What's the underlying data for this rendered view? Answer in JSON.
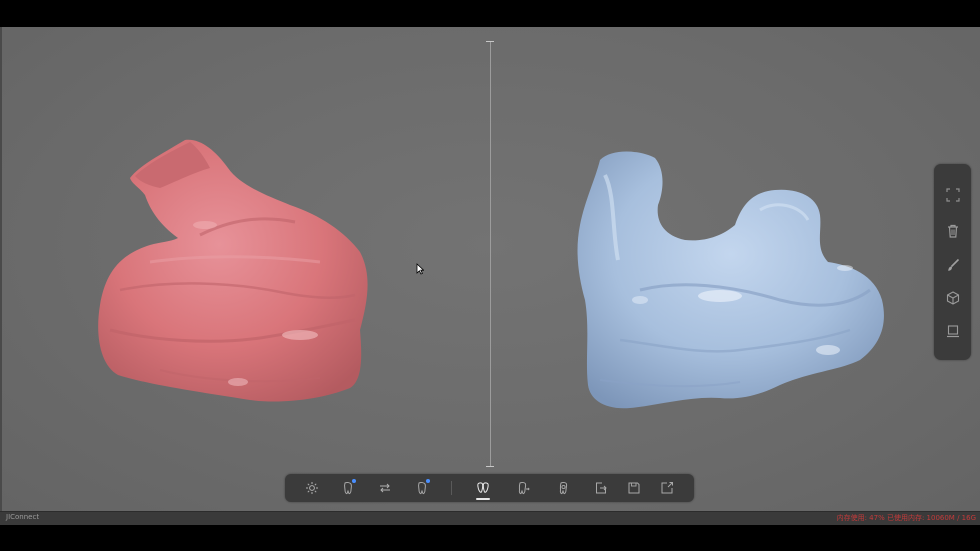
{
  "viewer": {
    "left_model": {
      "name": "pink-model",
      "color": "#d9757a"
    },
    "right_model": {
      "name": "blue-model",
      "color": "#a9c0de"
    },
    "background_color": "#6e6e6e"
  },
  "side_panel": {
    "buttons": [
      {
        "icon": "select-region-icon"
      },
      {
        "icon": "trash-icon"
      },
      {
        "icon": "brush-icon"
      },
      {
        "icon": "cube-icon"
      },
      {
        "icon": "monitor-icon"
      }
    ]
  },
  "toolbar": {
    "buttons": [
      {
        "icon": "light-icon"
      },
      {
        "icon": "tooth-left-icon"
      },
      {
        "icon": "swap-icon"
      },
      {
        "icon": "tooth-right-icon"
      },
      {
        "icon": "jaw-compare-icon"
      },
      {
        "icon": "tooth-rotate-icon"
      },
      {
        "icon": "tooth-align-icon"
      },
      {
        "icon": "export-icon"
      },
      {
        "icon": "save-icon"
      },
      {
        "icon": "share-icon"
      }
    ]
  },
  "status": {
    "left_text": "JIConnect",
    "right_text": "内存使用: 47% 已使用内存: 10060M / 16G"
  }
}
